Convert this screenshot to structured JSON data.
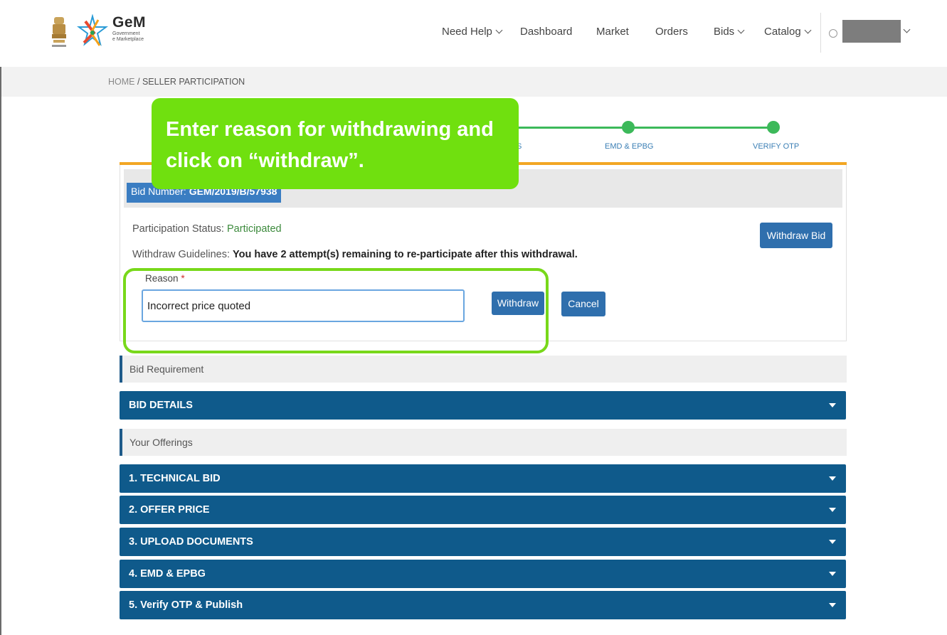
{
  "header": {
    "brand": {
      "title": "GeM",
      "subtitle_line1": "Government",
      "subtitle_line2": "e Marketplace"
    },
    "nav": [
      {
        "label": "Need Help",
        "dropdown": true
      },
      {
        "label": "Dashboard",
        "dropdown": false
      },
      {
        "label": "Market",
        "dropdown": false
      },
      {
        "label": "Orders",
        "dropdown": false
      },
      {
        "label": "Bids",
        "dropdown": true
      },
      {
        "label": "Catalog",
        "dropdown": true
      }
    ]
  },
  "breadcrumb": {
    "home": "HOME",
    "separator": "/",
    "current": "SELLER PARTICIPATION"
  },
  "stepper": {
    "steps": [
      {
        "label": "S"
      },
      {
        "label": "EMD & EPBG"
      },
      {
        "label": "VERIFY OTP"
      }
    ],
    "color": "#3cb95a"
  },
  "callout": {
    "line1": "Enter reason for withdrawing and",
    "line2": "click on “withdraw”.",
    "color": "#70e00f"
  },
  "panel": {
    "bid_number_label": "Bid Number:",
    "bid_number_value": "GEM/2019/B/57938",
    "status_label": "Participation Status:",
    "status_value": "Participated",
    "guidelines_label": "Withdraw Guidelines:",
    "guidelines_value": "You have 2 attempt(s) remaining to re-participate after this withdrawal.",
    "withdraw_bid_label": "Withdraw Bid",
    "reason_label": "Reason",
    "reason_required": "*",
    "reason_value": "Incorrect price quoted",
    "withdraw_label": "Withdraw",
    "cancel_label": "Cancel"
  },
  "sections": {
    "bid_requirement": "Bid Requirement",
    "bid_details": "BID DETAILS",
    "your_offerings": "Your Offerings",
    "offerings": [
      "1. TECHNICAL BID",
      "2. OFFER PRICE",
      "3. UPLOAD DOCUMENTS",
      "4. EMD & EPBG",
      "5. Verify OTP & Publish"
    ]
  },
  "colors": {
    "accent": "#0f5a8b",
    "button": "#2f6fad",
    "highlight": "#78d81a",
    "panel_top": "#f2a623"
  }
}
